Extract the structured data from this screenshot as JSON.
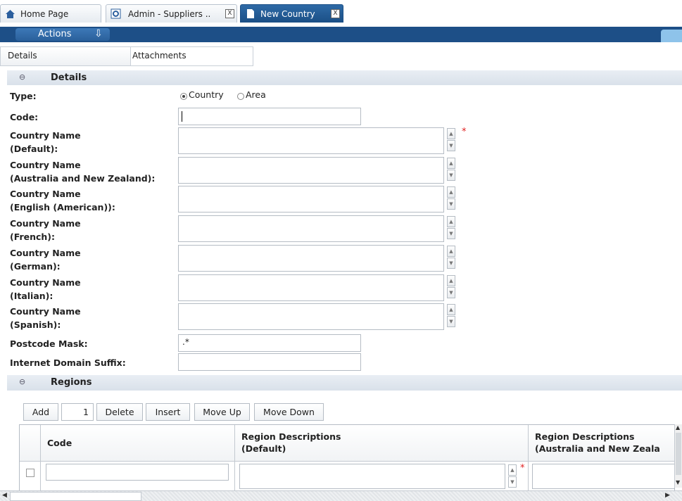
{
  "tabs": [
    {
      "label": "Home Page"
    },
    {
      "label": "Admin - Suppliers ..",
      "close": "X"
    },
    {
      "label": "New Country",
      "close": "X"
    }
  ],
  "actions": {
    "label": "Actions",
    "arrow": "⇩"
  },
  "subtabs": [
    {
      "label": "Details"
    },
    {
      "label": "Attachments"
    }
  ],
  "details": {
    "toggle": "⊖",
    "title": "Details",
    "type_label": "Type:",
    "type_options": [
      "Country",
      "Area"
    ],
    "type_selected": "Country",
    "code_label": "Code:",
    "code_value": "",
    "names": [
      {
        "line1": "Country Name",
        "line2": "(Default):",
        "required": true
      },
      {
        "line1": "Country Name",
        "line2": "(Australia and New Zealand):"
      },
      {
        "line1": "Country Name",
        "line2": "(English (American)):"
      },
      {
        "line1": "Country Name",
        "line2": "(French):"
      },
      {
        "line1": "Country Name",
        "line2": "(German):"
      },
      {
        "line1": "Country Name",
        "line2": "(Italian):"
      },
      {
        "line1": "Country Name",
        "line2": "(Spanish):"
      }
    ],
    "postcode_label": "Postcode Mask:",
    "postcode_value": ".*",
    "domain_label": "Internet Domain Suffix:",
    "domain_value": "",
    "required_mark": "*"
  },
  "regions": {
    "toggle": "⊖",
    "title": "Regions",
    "toolbar": {
      "add": "Add",
      "count": "1",
      "delete": "Delete",
      "insert": "Insert",
      "move_up": "Move Up",
      "move_down": "Move Down"
    },
    "columns": [
      {
        "line1": "Code",
        "line2": ""
      },
      {
        "line1": "Region Descriptions",
        "line2": "(Default)"
      },
      {
        "line1": "Region Descriptions",
        "line2": "(Australia and New Zeala"
      }
    ]
  },
  "colors": {
    "accent": "#1d4f87",
    "active_tab": "#1b4f86",
    "required": "#e02020"
  }
}
